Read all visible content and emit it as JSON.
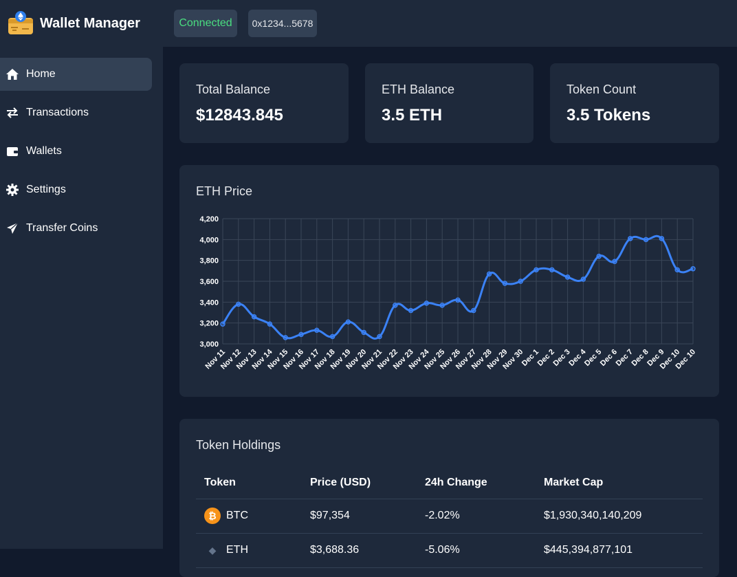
{
  "header": {
    "title": "Wallet Manager",
    "status": "Connected",
    "address": "0x1234...5678"
  },
  "sidebar": {
    "items": [
      {
        "label": "Home",
        "icon": "home-icon",
        "active": true
      },
      {
        "label": "Transactions",
        "icon": "arrows-exchange-icon",
        "active": false
      },
      {
        "label": "Wallets",
        "icon": "wallet-icon",
        "active": false
      },
      {
        "label": "Settings",
        "icon": "gear-icon",
        "active": false
      },
      {
        "label": "Transfer Coins",
        "icon": "paper-plane-icon",
        "active": false
      }
    ]
  },
  "stats": [
    {
      "label": "Total Balance",
      "value": "$12843.845"
    },
    {
      "label": "ETH Balance",
      "value": "3.5 ETH"
    },
    {
      "label": "Token Count",
      "value": "3.5 Tokens"
    }
  ],
  "chart_section": {
    "title": "ETH Price"
  },
  "chart_data": {
    "type": "line",
    "title": "ETH Price",
    "xlabel": "",
    "ylabel": "",
    "ylim": [
      3000,
      4200
    ],
    "yticks": [
      "3,000",
      "3,200",
      "3,400",
      "3,600",
      "3,800",
      "4,000",
      "4,200"
    ],
    "grid": true,
    "color": "#3b82f6",
    "categories": [
      "Nov 11",
      "Nov 12",
      "Nov 13",
      "Nov 14",
      "Nov 15",
      "Nov 16",
      "Nov 17",
      "Nov 18",
      "Nov 19",
      "Nov 20",
      "Nov 21",
      "Nov 22",
      "Nov 23",
      "Nov 24",
      "Nov 25",
      "Nov 26",
      "Nov 27",
      "Nov 28",
      "Nov 29",
      "Nov 30",
      "Dec 1",
      "Dec 2",
      "Dec 3",
      "Dec 4",
      "Dec 5",
      "Dec 6",
      "Dec 7",
      "Dec 8",
      "Dec 9",
      "Dec 10",
      "Dec 10"
    ],
    "values": [
      3190,
      3380,
      3260,
      3190,
      3060,
      3090,
      3130,
      3070,
      3210,
      3110,
      3070,
      3370,
      3320,
      3390,
      3370,
      3420,
      3320,
      3670,
      3580,
      3600,
      3710,
      3710,
      3640,
      3620,
      3840,
      3790,
      4010,
      4000,
      4010,
      3710,
      3720
    ]
  },
  "holdings": {
    "title": "Token Holdings",
    "columns": [
      "Token",
      "Price (USD)",
      "24h Change",
      "Market Cap"
    ],
    "rows": [
      {
        "token": "BTC",
        "icon": "bitcoin-icon",
        "icon_color": "#f7931a",
        "icon_glyph": "₿",
        "price": "$97,354",
        "change": "-2.02%",
        "market_cap": "$1,930,340,140,209"
      },
      {
        "token": "ETH",
        "icon": "ethereum-icon",
        "icon_color": "#64748b",
        "icon_glyph": "◆",
        "price": "$3,688.36",
        "change": "-5.06%",
        "market_cap": "$445,394,877,101"
      }
    ]
  }
}
